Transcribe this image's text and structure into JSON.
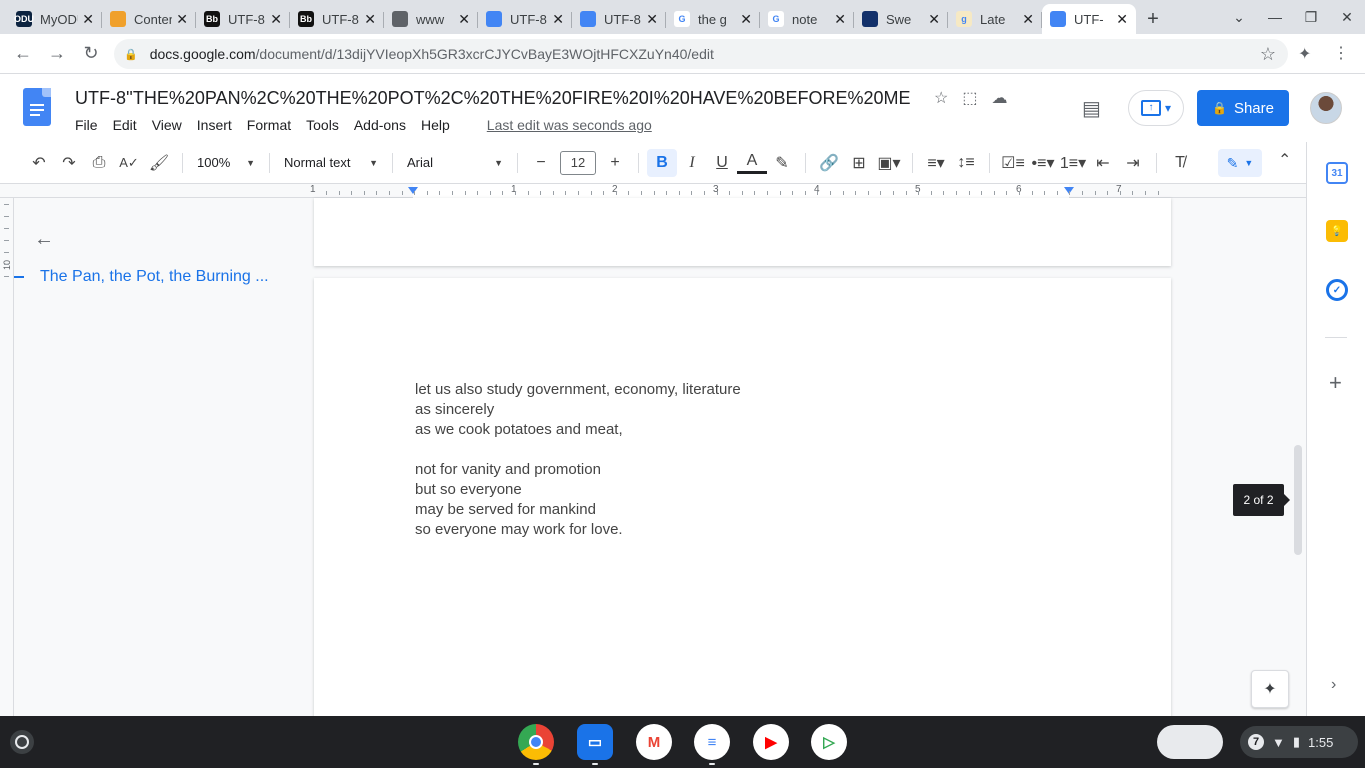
{
  "browser": {
    "tabs": [
      {
        "title": "MyODU",
        "favicon_text": "ODU",
        "favicon_color": "#0c2340",
        "active": false
      },
      {
        "title": "Content",
        "favicon_text": "",
        "favicon_color": "#f0a02b",
        "active": false
      },
      {
        "title": "UTF-8",
        "favicon_text": "Bb",
        "favicon_color": "#111111",
        "active": false
      },
      {
        "title": "UTF-8",
        "favicon_text": "Bb",
        "favicon_color": "#111111",
        "active": false
      },
      {
        "title": "www",
        "favicon_text": "",
        "favicon_color": "#5f6368",
        "active": false
      },
      {
        "title": "UTF-8",
        "favicon_text": "",
        "favicon_color": "#4285f4",
        "active": false
      },
      {
        "title": "UTF-8",
        "favicon_text": "",
        "favicon_color": "#4285f4",
        "active": false
      },
      {
        "title": "the g",
        "favicon_text": "G",
        "favicon_color": "#ffffff",
        "active": false
      },
      {
        "title": "note",
        "favicon_text": "G",
        "favicon_color": "#ffffff",
        "active": false
      },
      {
        "title": "Swe",
        "favicon_text": "",
        "favicon_color": "#12306a",
        "active": false
      },
      {
        "title": "Late",
        "favicon_text": "g",
        "favicon_color": "#f6e9c4",
        "active": false
      },
      {
        "title": "UTF-",
        "favicon_text": "",
        "favicon_color": "#4285f4",
        "active": true
      }
    ],
    "url_host": "docs.google.com",
    "url_path": "/document/d/13dijYVIeopXh5GR3xcrCJYCvBayE3WOjtHFCXZuYn40/edit"
  },
  "doc": {
    "title": "UTF-8''THE%20PAN%2C%20THE%20POT%2C%20THE%20FIRE%20I%20HAVE%20BEFORE%20ME",
    "menus": [
      "File",
      "Edit",
      "View",
      "Insert",
      "Format",
      "Tools",
      "Add-ons",
      "Help"
    ],
    "last_edit": "Last edit was seconds ago",
    "share_label": "Share"
  },
  "toolbar": {
    "zoom": "100%",
    "style": "Normal text",
    "font": "Arial",
    "font_size": "12"
  },
  "ruler": {
    "labels": [
      "1",
      "1",
      "2",
      "3",
      "4",
      "5",
      "6",
      "7"
    ]
  },
  "vruler": {
    "label": "10"
  },
  "outline": {
    "heading": "The Pan, the Pot, the Burning ..."
  },
  "body": {
    "lines": [
      "let us also study government, economy, literature",
      "as sincerely",
      "as we cook potatoes and meat,",
      "",
      "not for vanity and promotion",
      "but so everyone",
      "may be served for mankind",
      "so everyone may work for love."
    ]
  },
  "pager": "2 of 2",
  "side_panel": {
    "calendar_day": "31"
  },
  "shelf": {
    "notification_count": "7",
    "time": "1:55"
  },
  "colors": {
    "accent": "#1a73e8",
    "docs_blue": "#4285f4"
  }
}
